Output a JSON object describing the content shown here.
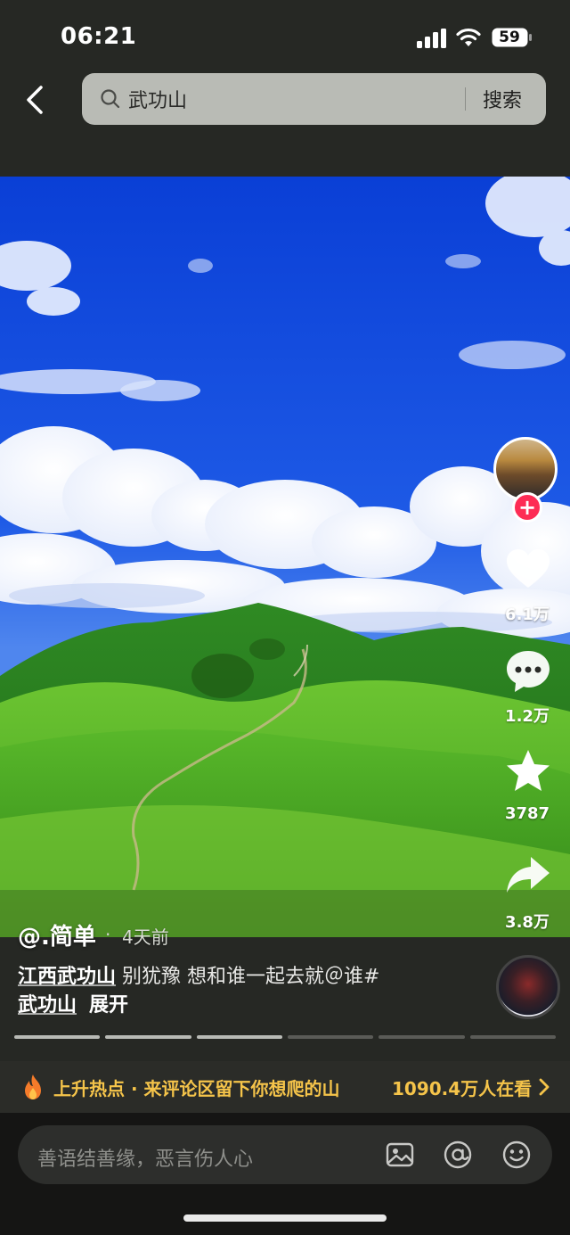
{
  "status_bar": {
    "time": "06:21",
    "battery": "59"
  },
  "header": {
    "search_query": "武功山",
    "search_button": "搜索"
  },
  "video": {
    "author": "@.简单",
    "posted": "4天前",
    "caption": {
      "tag": "江西武功山",
      "text": " 别犹豫 想和谁一起去就＠谁#",
      "tag2": "武功山",
      "expand": "展开"
    },
    "actions": {
      "likes": "6.1万",
      "comments": "1.2万",
      "favorites": "3787",
      "shares": "3.8万"
    },
    "progress_segments": 6,
    "progress_current": 3
  },
  "hot_bar": {
    "text": "上升热点 · 来评论区留下你想爬的山",
    "watching": "1090.4万人在看"
  },
  "comment_input": {
    "placeholder": "善语结善缘，恶言伤人心"
  },
  "colors": {
    "accent_red": "#fd2c55",
    "hot_gold": "#f5c44a",
    "sky": "#1448d8",
    "grass": "#4fb72b"
  },
  "icons": [
    "back-arrow-icon",
    "search-icon",
    "heart-icon",
    "comment-icon",
    "star-icon",
    "share-icon",
    "fire-icon",
    "image-icon",
    "at-icon",
    "emoji-icon"
  ]
}
